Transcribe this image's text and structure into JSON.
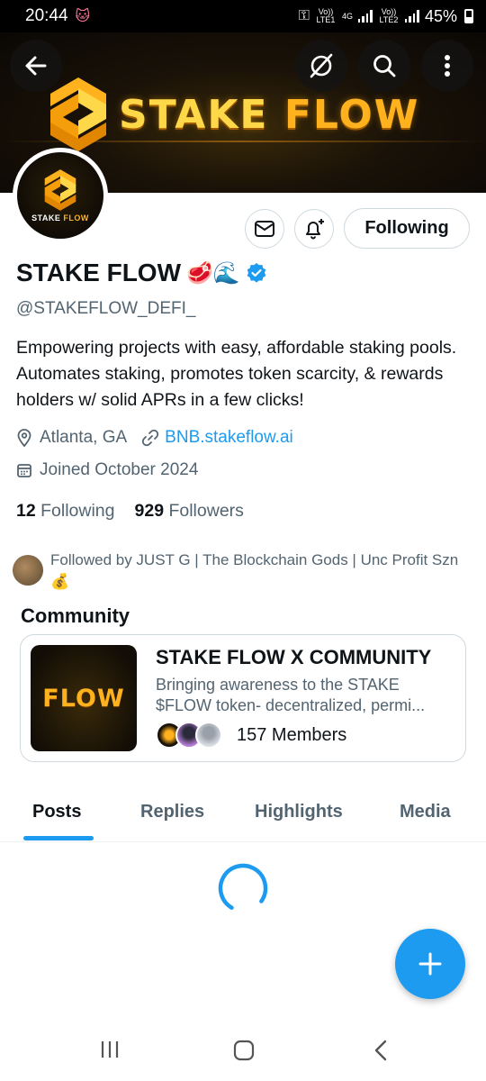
{
  "status_bar": {
    "time": "20:44",
    "network_4g": "4G",
    "sim1": "Vo)) LTE1",
    "sim2": "Vo)) LTE2",
    "battery": "45%"
  },
  "banner": {
    "title_part1": "STAKE",
    "title_part2": "FLOW"
  },
  "avatar": {
    "label_part1": "STAKE",
    "label_part2": "FLOW"
  },
  "actions": {
    "following_label": "Following"
  },
  "profile": {
    "display_name": "STAKE FLOW",
    "name_emojis": "🥩🌊",
    "handle": "@STAKEFLOW_DEFI_",
    "bio": "Empowering projects with easy, affordable staking pools. Automates staking, promotes token scarcity, & rewards holders w/ solid APRs in a few clicks!",
    "location": "Atlanta, GA",
    "website": "BNB.stakeflow.ai",
    "joined": "Joined October 2024",
    "following_count": "12",
    "following_label": "Following",
    "followers_count": "929",
    "followers_label": "Followers",
    "followed_by": "Followed by JUST G | The Blockchain Gods | Unc Profit Szn 💰"
  },
  "community": {
    "section_label": "Community",
    "thumb_text": "FLOW",
    "title": "STAKE FLOW X COMMUNITY",
    "desc_line1": "Bringing awareness to the STAKE",
    "desc_line2": "$FLOW token- decentralized, permi...",
    "members": "157 Members"
  },
  "tabs": [
    {
      "label": "Posts"
    },
    {
      "label": "Replies"
    },
    {
      "label": "Highlights"
    },
    {
      "label": "Media"
    }
  ],
  "colors": {
    "accent": "#1d9bf0",
    "brand_gold": "#ffb21e",
    "secondary_text": "#536471"
  }
}
